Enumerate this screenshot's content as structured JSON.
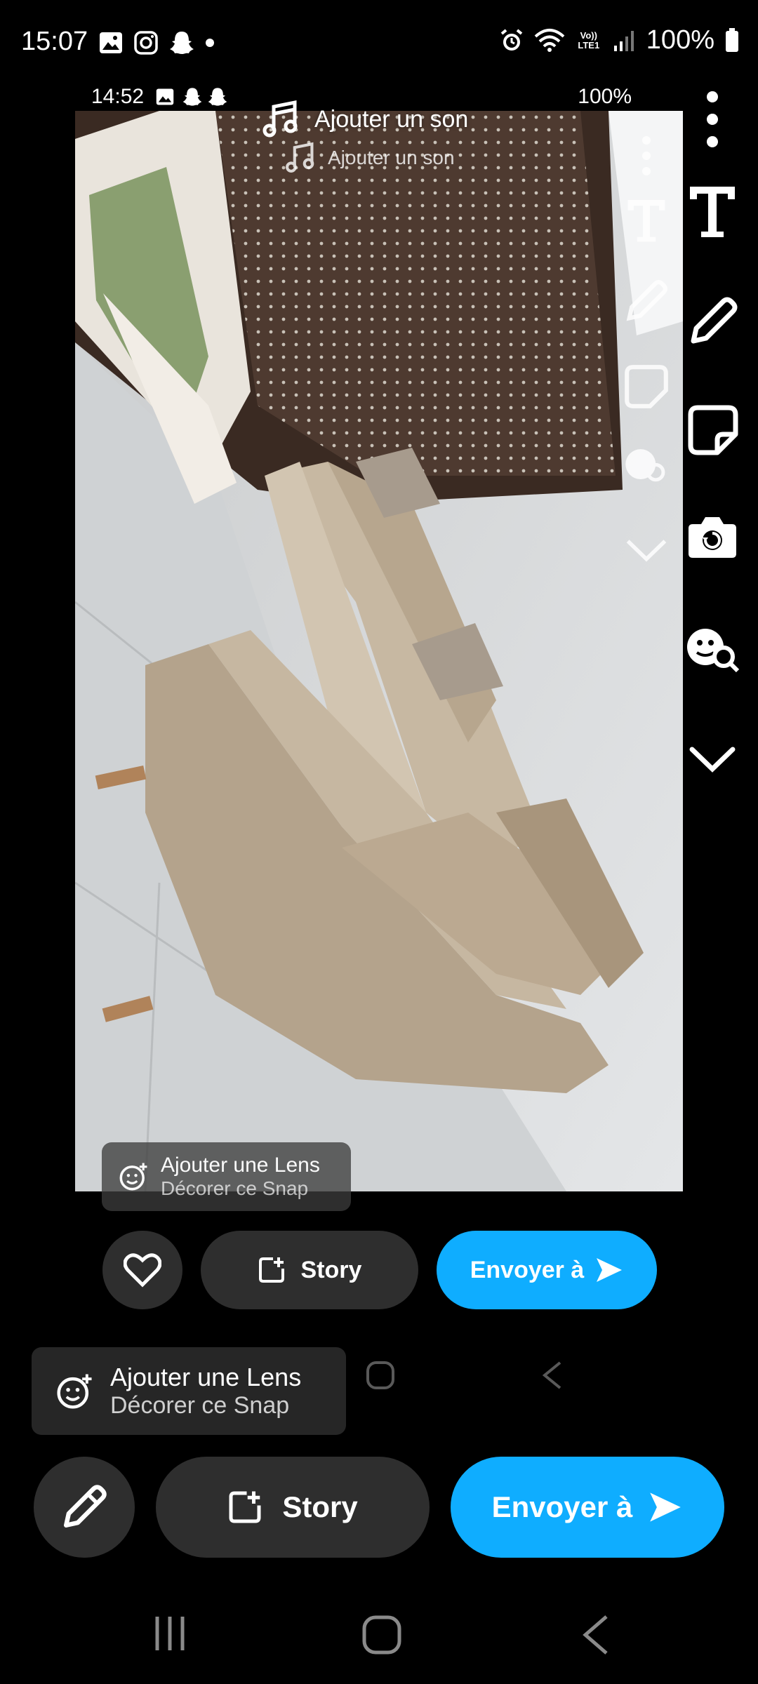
{
  "status_bar": {
    "time": "15:07",
    "battery": "100%",
    "net_label": "Vo)) LTE1"
  },
  "inner_status_bar": {
    "time": "14:52",
    "battery": "100%"
  },
  "add_sound": {
    "label": "Ajouter un son",
    "inner_label": "Ajouter un son"
  },
  "lens": {
    "title": "Ajouter une Lens",
    "subtitle": "Décorer ce Snap",
    "inner_title": "Ajouter une Lens",
    "inner_subtitle": "Décorer ce Snap"
  },
  "actions": {
    "story_label": "Story",
    "send_label": "Envoyer à",
    "inner_story_label": "Story",
    "inner_send_label": "Envoyer à"
  },
  "toolbar_icons": [
    "more-icon",
    "text-icon",
    "pencil-icon",
    "sticker-icon",
    "lens-camera-icon",
    "sticker-search-icon",
    "chevron-down-icon"
  ],
  "colors": {
    "accent": "#0fadff",
    "dark_button": "#2e2e2e"
  }
}
